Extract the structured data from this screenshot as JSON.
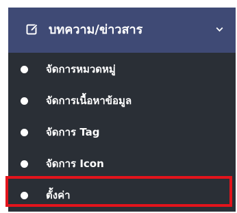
{
  "menu": {
    "header": {
      "icon": "edit-icon",
      "label": "บทความ/ข่าวสาร",
      "chevron_icon": "chevron-down-icon"
    },
    "items": [
      {
        "label": "จัดการหมวดหมู่",
        "icon": "bullet-icon"
      },
      {
        "label": "จัดการเนื้อหาข้อมูล",
        "icon": "bullet-icon"
      },
      {
        "label": "จัดการ Tag",
        "icon": "bullet-icon"
      },
      {
        "label": "จัดการ Icon",
        "icon": "bullet-icon"
      },
      {
        "label": "ตั้งค่า",
        "icon": "bullet-icon",
        "highlighted": true
      }
    ]
  },
  "colors": {
    "header_bg": "#3f4a75",
    "submenu_bg": "#2a2f36",
    "text": "#ffffff",
    "highlight_border": "#e3141c"
  }
}
